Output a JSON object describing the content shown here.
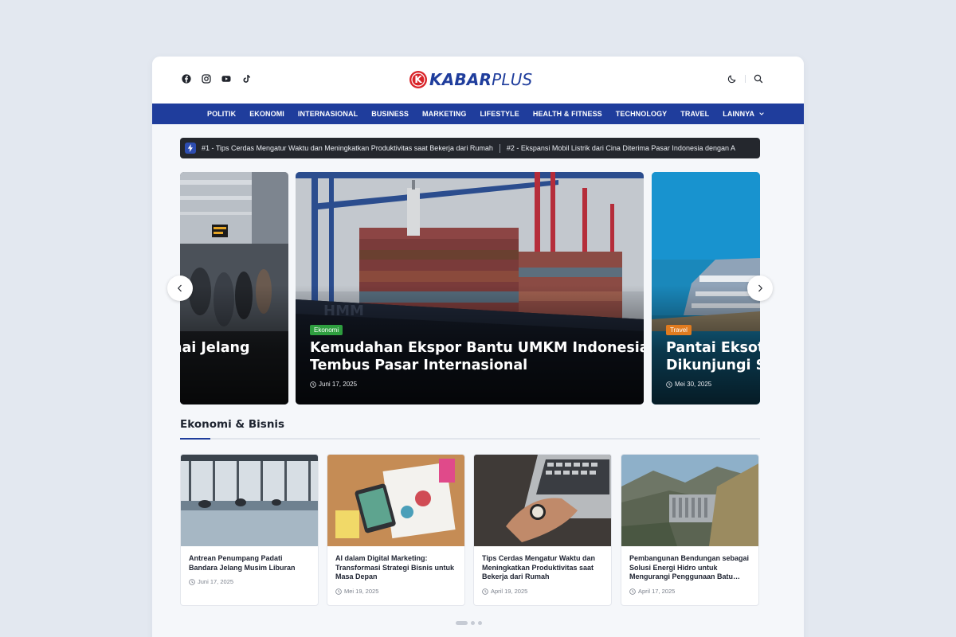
{
  "social": {
    "icons": [
      "facebook-icon",
      "instagram-icon",
      "youtube-icon",
      "tiktok-icon"
    ]
  },
  "brand": {
    "name_bold": "KABAR",
    "name_light": "PLUS",
    "logo_letter": "K"
  },
  "nav": {
    "items": [
      "POLITIK",
      "EKONOMI",
      "INTERNASIONAL",
      "BUSINESS",
      "MARKETING",
      "LIFESTYLE",
      "HEALTH & FITNESS",
      "TECHNOLOGY",
      "TRAVEL"
    ],
    "more": "LAINNYA"
  },
  "ticker": {
    "items": [
      "#1 - Tips Cerdas Mengatur Waktu dan Meningkatkan Produktivitas saat Bekerja dari Rumah",
      "#2 - Ekspansi Mobil Listrik dari Cina Diterima Pasar Indonesia dengan A"
    ]
  },
  "slider": {
    "slides": [
      {
        "title_lines": [
          "nai Jelang"
        ],
        "category": "",
        "date": ""
      },
      {
        "category": "Ekonomi",
        "category_color": "#2e9e3f",
        "title_lines": [
          "Kemudahan Ekspor Bantu UMKM Indonesia",
          "Tembus Pasar Internasional"
        ],
        "date": "Juni 17, 2025"
      },
      {
        "category": "Travel",
        "category_color": "#e07b1f",
        "title_lines": [
          "Pantai Eksotis",
          "Dikunjungi Sa"
        ],
        "date": "Mei 30, 2025"
      }
    ]
  },
  "section": {
    "title": "Ekonomi & Bisnis"
  },
  "cards": [
    {
      "title": "Antrean Penumpang Padati Bandara Jelang Musim Liburan",
      "date": "Juni 17, 2025"
    },
    {
      "title": "AI dalam Digital Marketing: Transformasi Strategi Bisnis untuk Masa Depan",
      "date": "Mei 19, 2025"
    },
    {
      "title": "Tips Cerdas Mengatur Waktu dan Meningkatkan Produktivitas saat Bekerja dari Rumah",
      "date": "April 19, 2025"
    },
    {
      "title": "Pembangunan Bendungan sebagai Solusi Energi Hidro untuk Mengurangi Penggunaan Batu…",
      "date": "April 17, 2025"
    }
  ],
  "pagination": {
    "count": 3,
    "active": 1
  },
  "colors": {
    "brand_blue": "#1f3d9c",
    "logo_red": "#d9252a",
    "ticker_bg": "#24272d"
  }
}
